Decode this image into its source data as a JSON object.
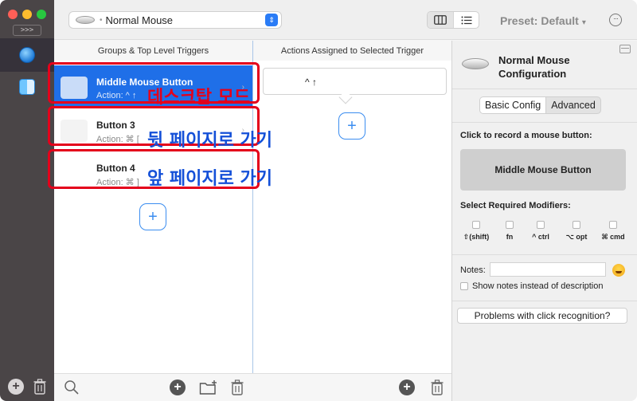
{
  "app": {
    "collapse_label": ">>>"
  },
  "toolbar": {
    "device_label": "Normal Mouse",
    "preset_label": "Preset: Default",
    "preset_caret": "▾",
    "more_label": "···"
  },
  "columns": {
    "groups_header": "Groups & Top Level Triggers",
    "actions_header": "Actions Assigned to Selected Trigger"
  },
  "triggers": [
    {
      "title": "Middle Mouse Button",
      "action": "Action: ^ ↑",
      "annotation": "데스크탑 모드",
      "selected": true
    },
    {
      "title": "Button 3",
      "action": "Action: ⌘ [",
      "annotation": "뒷 페이지로 가기",
      "selected": false
    },
    {
      "title": "Button 4",
      "action": "Action: ⌘ ]",
      "annotation": "앞 페이지로 가기",
      "selected": false
    }
  ],
  "actions_pane": {
    "assigned_action": "^ ↑"
  },
  "add_label": "+",
  "config": {
    "title": "Normal Mouse Configuration",
    "tab_basic": "Basic Config",
    "tab_advanced": "Advanced",
    "record_label": "Click to record a mouse button:",
    "record_button": "Middle Mouse Button",
    "modifiers_label": "Select Required Modifiers:",
    "modifiers": [
      "⇧(shift)",
      "fn",
      "^ ctrl",
      "⌥ opt",
      "⌘ cmd"
    ],
    "notes_label": "Notes:",
    "show_notes_label": "Show notes instead of description",
    "problems_button": "Problems with click recognition?"
  },
  "colors": {
    "selected_row": "#1f6fe8",
    "annotation_red": "#e4001b",
    "annotation_blue": "#1450d8",
    "accent_blue": "#3b8df0"
  }
}
